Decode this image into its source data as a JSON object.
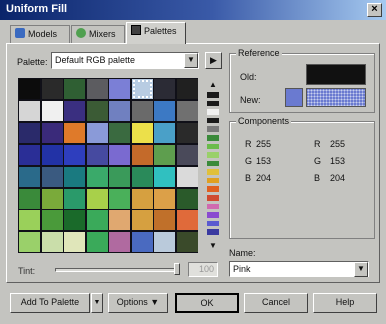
{
  "window": {
    "title": "Uniform Fill",
    "close_glyph": "×"
  },
  "tabs": [
    {
      "label": "Models",
      "icon": "models-icon",
      "color": "#3a6ac0"
    },
    {
      "label": "Mixers",
      "icon": "mixers-icon",
      "color": "#50a050"
    },
    {
      "label": "Palettes",
      "icon": "palettes-icon",
      "color": "#404040"
    }
  ],
  "palette": {
    "label": "Palette:",
    "value": "Default RGB palette",
    "arrow": "▼",
    "menu_glyph": "▶"
  },
  "grid": {
    "rows": [
      [
        "#0c0c0c",
        "#2a2a2a",
        "#2f5f33",
        "#5c5c60",
        "#7b7fd6",
        "#b8cce2",
        "#2b2b35",
        "#202020"
      ],
      [
        "#d6d6d6",
        "#f0f0f0",
        "#3a2f80",
        "#3b5b35",
        "#7080c0",
        "#6a6a6a",
        "#3c79c4",
        "#707070"
      ],
      [
        "#2a2a6a",
        "#3a2a7a",
        "#df7a2a",
        "#8a9ad8",
        "#3a6a40",
        "#ece04a",
        "#4aa0c8",
        "#2a2a2a"
      ],
      [
        "#2a2e96",
        "#2232a6",
        "#2e3ebe",
        "#464aa0",
        "#7a6ad0",
        "#c46a2a",
        "#5e9e4e",
        "#4a4a5a"
      ],
      [
        "#2a6a8a",
        "#3a5a80",
        "#1a7a80",
        "#3aaa6a",
        "#3a9a5a",
        "#2a8a5a",
        "#30c0c0",
        "#dadada"
      ],
      [
        "#3a8a3a",
        "#7aaa3a",
        "#2a9a6a",
        "#a8d04a",
        "#4ab05a",
        "#d6a040",
        "#dca048",
        "#2a5a2a"
      ],
      [
        "#9ad05a",
        "#4a9a3a",
        "#1a6a2a",
        "#3aaa5a",
        "#e0a870",
        "#d6a040",
        "#c0702a",
        "#e06a3a"
      ],
      [
        "#9ad06a",
        "#cadeaa",
        "#e0e6ba",
        "#3aaa5a",
        "#b06aa0",
        "#4a6ac0",
        "#bacadb",
        "#3a4a2a"
      ]
    ],
    "selected": {
      "row": 0,
      "col": 5
    }
  },
  "strip": {
    "up_glyph": "▲",
    "down_glyph": "▼",
    "colors": [
      "#1a1a1a",
      "#1a1a1a",
      "#f0f0f0",
      "#1a1a1a",
      "#7a7a7a",
      "#3a8a3a",
      "#6abc4a",
      "#9ad06a",
      "#3a8a3a",
      "#e0c03a",
      "#e0a020",
      "#e06020",
      "#d04a30",
      "#d06ab0",
      "#8a4ad0",
      "#5a5ad0",
      "#3a3aa0"
    ]
  },
  "tint": {
    "label": "Tint:",
    "value": "100",
    "level": 1.0
  },
  "reference": {
    "title": "Reference",
    "old_label": "Old:",
    "new_label": "New:",
    "old_color": "#111111",
    "new_color": "#6a7ad0"
  },
  "components": {
    "title": "Components",
    "left": [
      {
        "label": "R",
        "value": "255"
      },
      {
        "label": "G",
        "value": "153"
      },
      {
        "label": "B",
        "value": "204"
      }
    ],
    "right": [
      {
        "label": "R",
        "value": "255"
      },
      {
        "label": "G",
        "value": "153"
      },
      {
        "label": "B",
        "value": "204"
      }
    ]
  },
  "name": {
    "label": "Name:",
    "value": "Pink",
    "arrow": "▼"
  },
  "buttons": {
    "add_palette": "Add To Palette",
    "add_arrow": "▼",
    "options": "Options ▼",
    "ok": "OK",
    "cancel": "Cancel",
    "help": "Help"
  }
}
